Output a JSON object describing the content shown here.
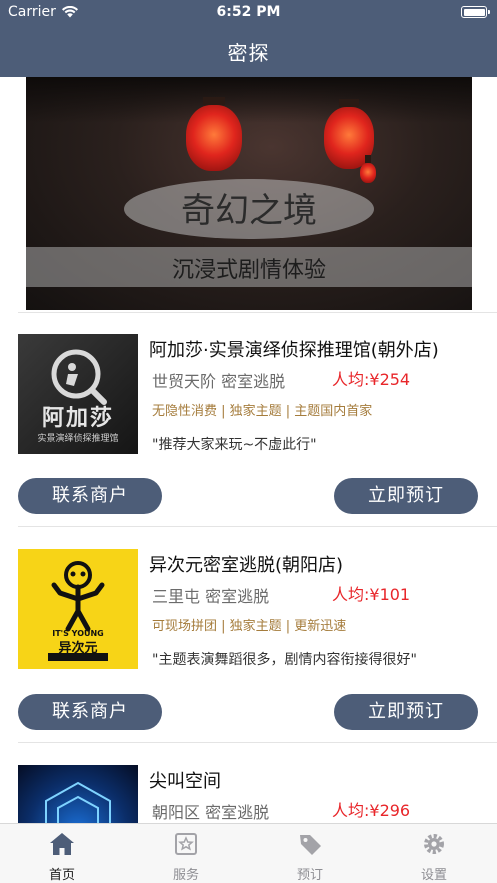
{
  "status": {
    "carrier": "Carrier",
    "time": "6:52 PM"
  },
  "nav": {
    "title": "密探"
  },
  "banner": {
    "main": "奇幻之境",
    "sub": "沉浸式剧情体验"
  },
  "shops": [
    {
      "name": "阿加莎·实景演绎侦探推理馆(朝外店)",
      "area": "世贸天阶  密室逃脱",
      "price": "人均:¥254",
      "tags": "无隐性消费 | 独家主题 | 主题国内首家",
      "quote": "\"推荐大家来玩~不虚此行\"",
      "logo_text": "阿加莎",
      "logo_sub": "实景演绎侦探推理馆"
    },
    {
      "name": "异次元密室逃脱(朝阳店)",
      "area": "三里屯  密室逃脱",
      "price": "人均:¥101",
      "tags": "可现场拼团 | 独家主题 | 更新迅速",
      "quote": "\"主题表演舞蹈很多，剧情内容衔接得很好\"",
      "logo_text": "异次元",
      "logo_sub": "IT'S YOUNG"
    },
    {
      "name": "尖叫空间",
      "area": "朝阳区  密室逃脱",
      "price": "人均:¥296"
    }
  ],
  "buttons": {
    "contact": "联系商户",
    "book": "立即预订"
  },
  "tabs": [
    {
      "label": "首页",
      "icon": "home-icon"
    },
    {
      "label": "服务",
      "icon": "star-card-icon"
    },
    {
      "label": "预订",
      "icon": "tag-icon"
    },
    {
      "label": "设置",
      "icon": "gear-icon"
    }
  ],
  "colors": {
    "navbar": "#4d5d78",
    "price": "#e8262a",
    "tags": "#a57c3c",
    "logo_yellow": "#f7d417"
  }
}
